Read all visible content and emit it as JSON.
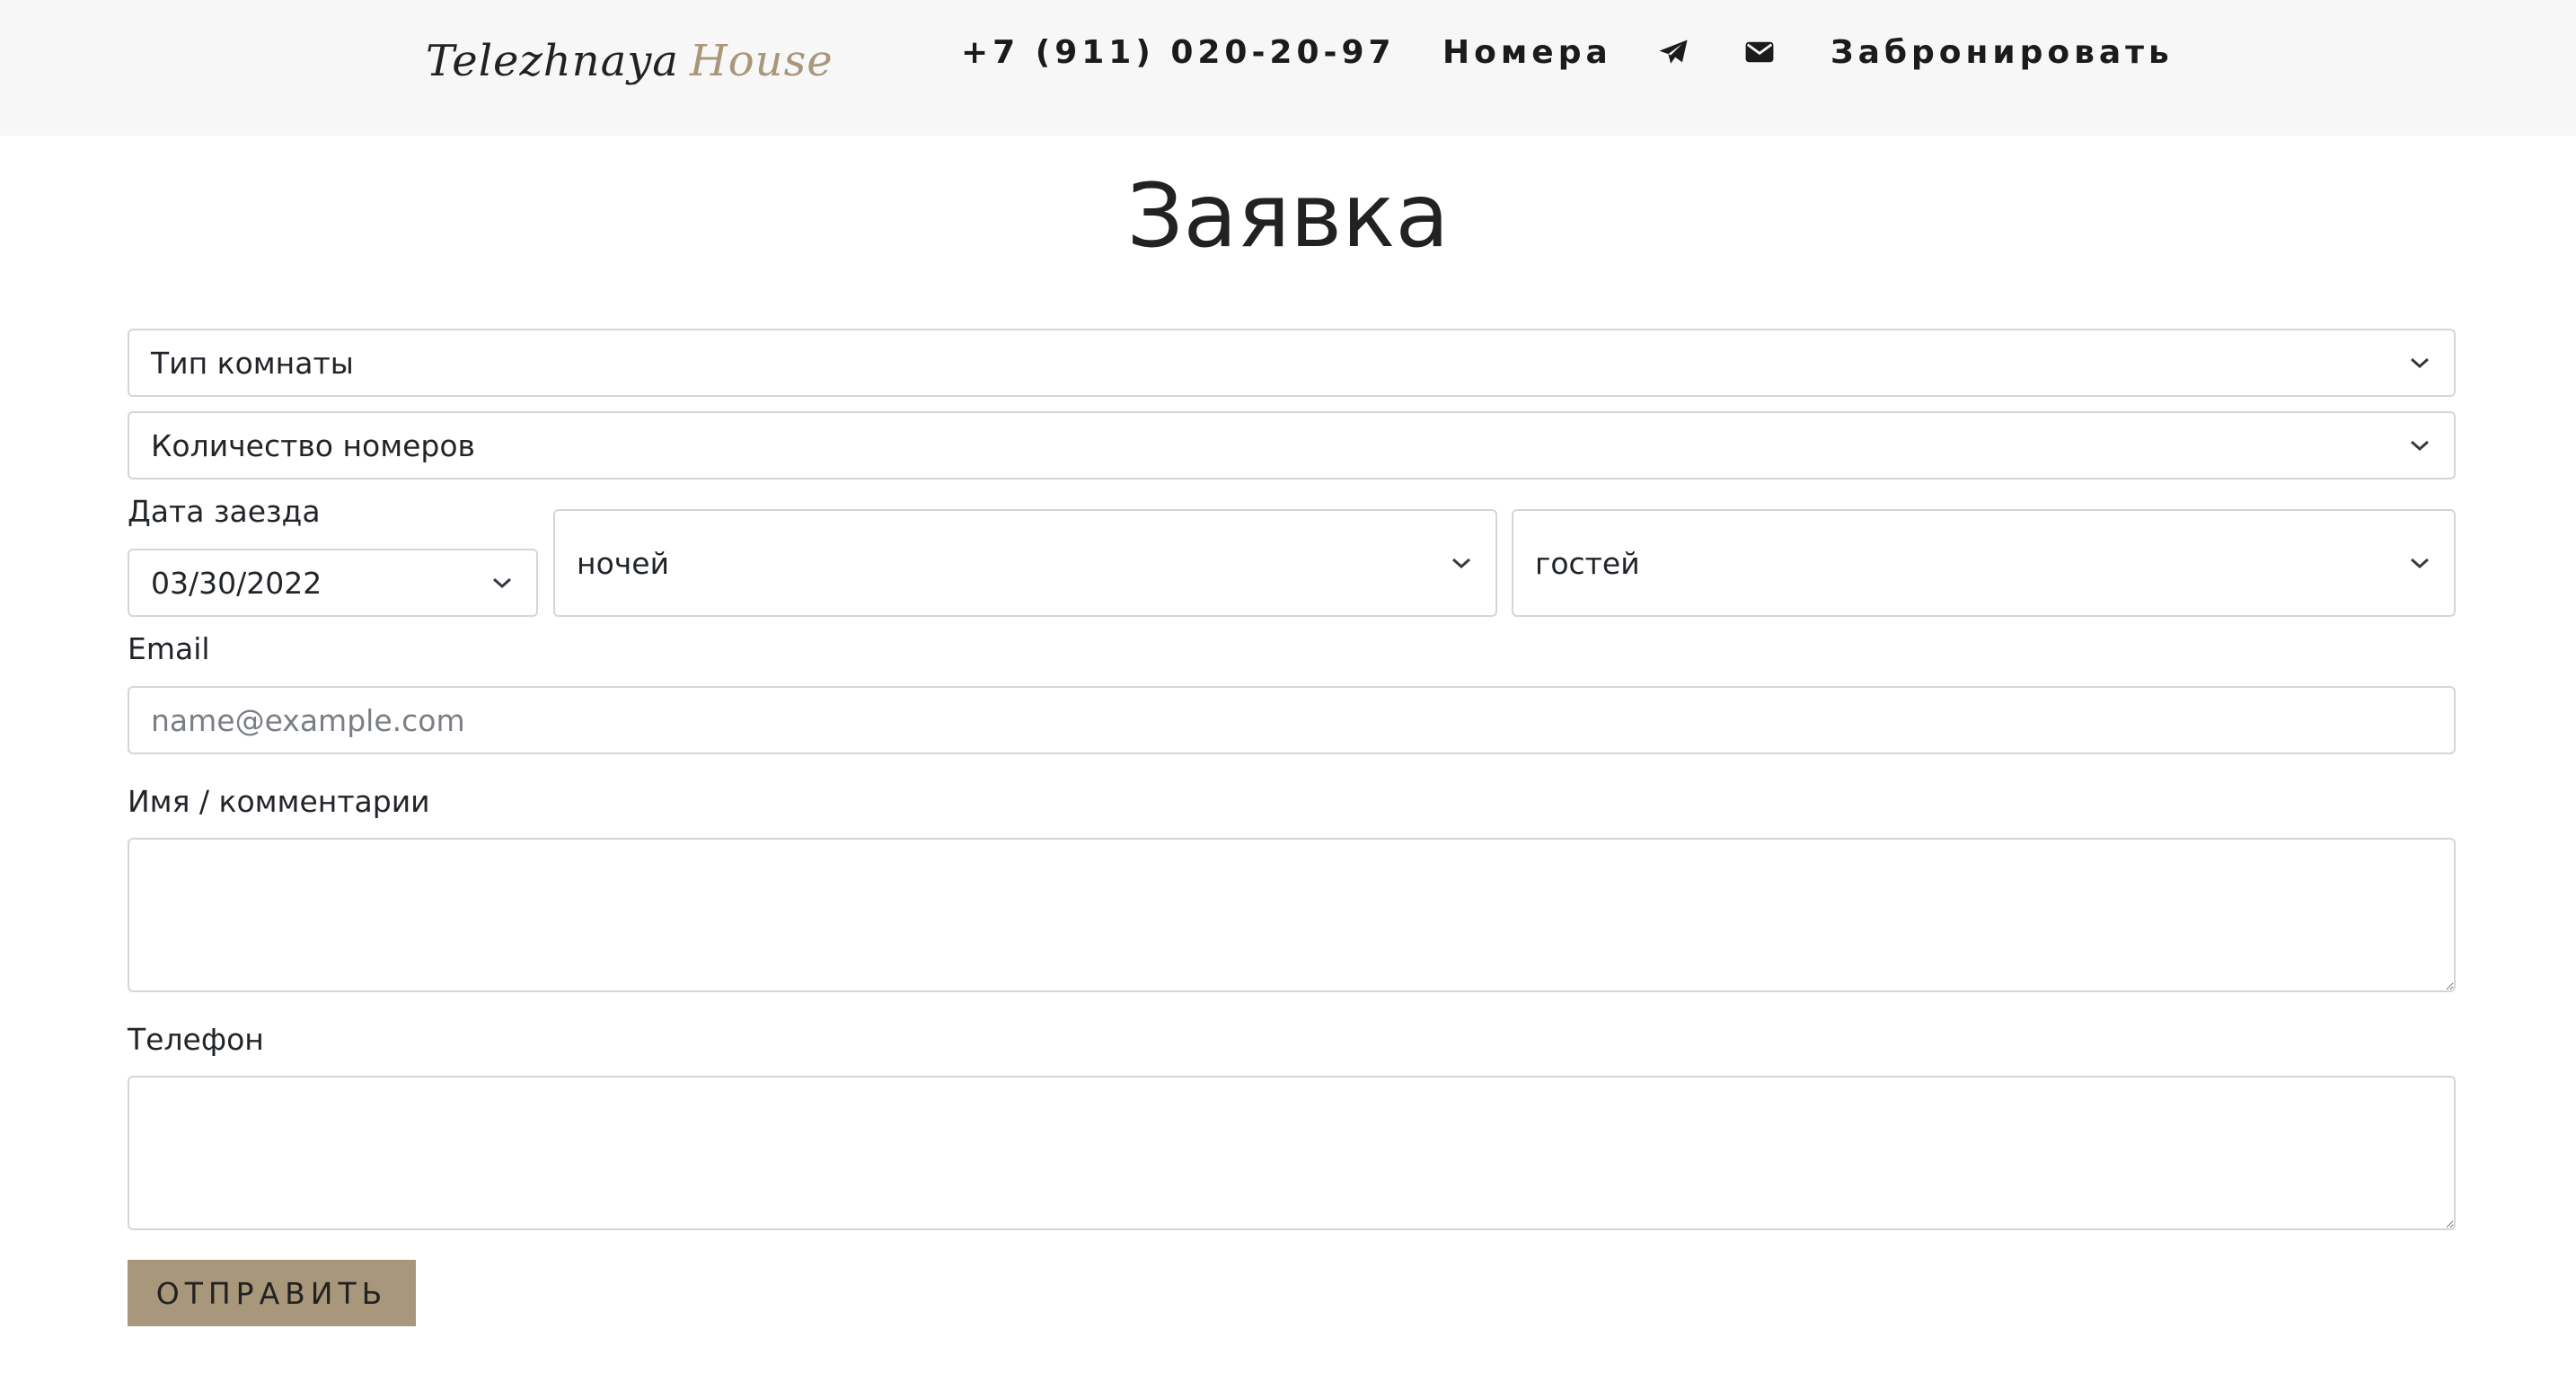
{
  "header": {
    "logo": {
      "part1": "Telezhnaya",
      "part2": "House"
    },
    "nav": {
      "phone": "+7 (911) 020-20-97",
      "rooms": "Номера",
      "telegram_icon": "telegram-icon",
      "mail_icon": "envelope-icon",
      "book": "Забронировать"
    }
  },
  "form": {
    "title": "Заявка",
    "room_type": {
      "value": "Тип комнаты"
    },
    "room_count": {
      "value": "Количество номеров"
    },
    "checkin": {
      "label": "Дата заезда",
      "value": "03/30/2022"
    },
    "nights": {
      "value": "ночей"
    },
    "guests": {
      "value": "гостей"
    },
    "email": {
      "label": "Email",
      "placeholder": "name@example.com",
      "value": ""
    },
    "name_comments": {
      "label": "Имя / комментарии",
      "value": ""
    },
    "phone": {
      "label": "Телефон",
      "value": ""
    },
    "submit_label": "ОТПРАВИТЬ"
  },
  "colors": {
    "header_bg": "#f7f7f7",
    "accent": "#a8977a",
    "text": "#212529",
    "border": "#d3d6d9"
  }
}
